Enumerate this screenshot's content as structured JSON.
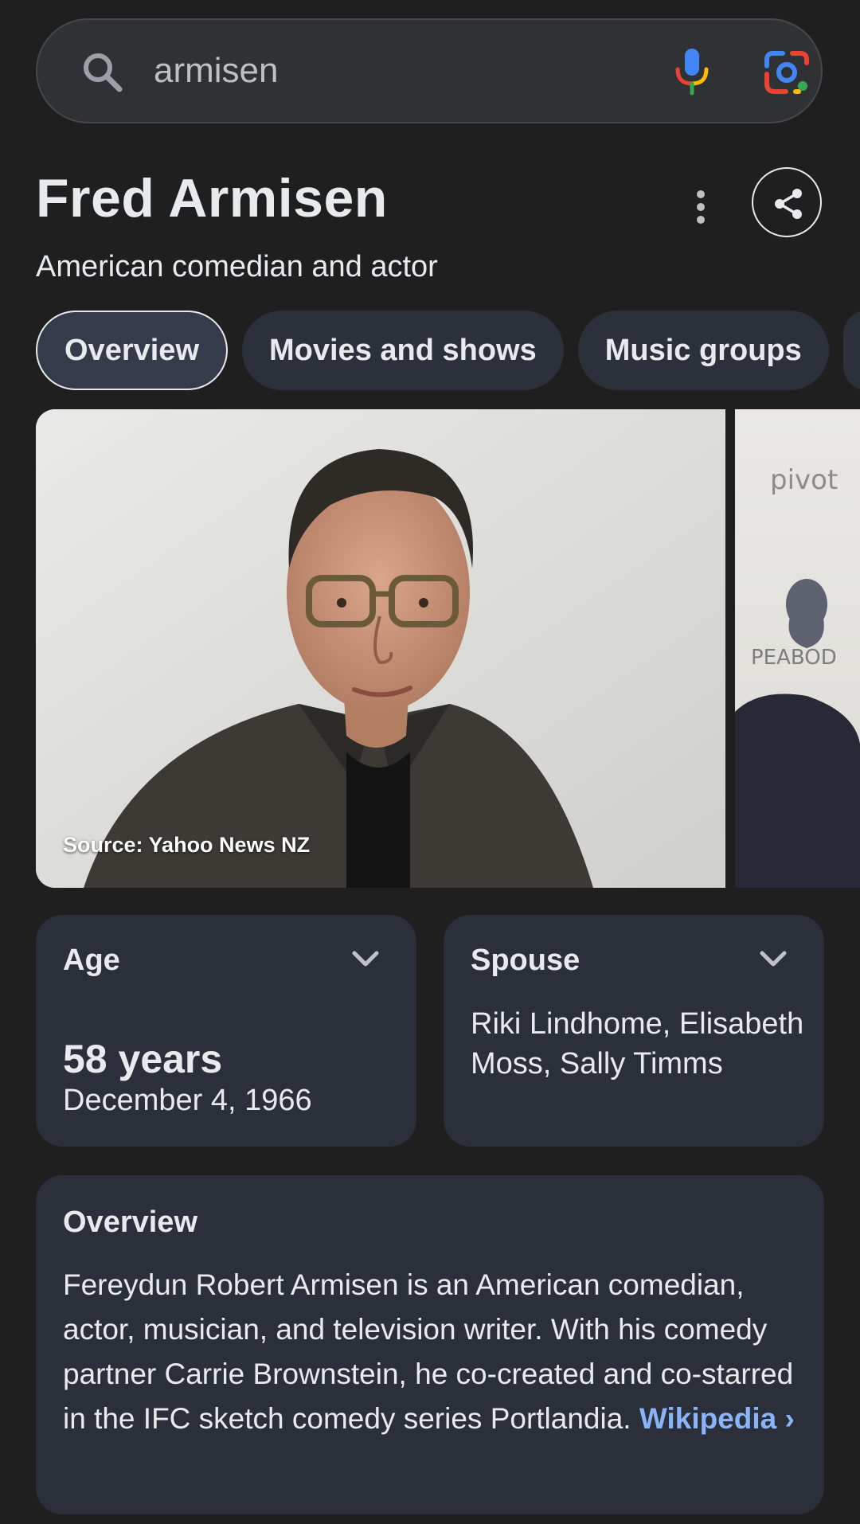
{
  "search": {
    "query": "armisen"
  },
  "header": {
    "title": "Fred Armisen",
    "subtitle": "American comedian and actor"
  },
  "chips": [
    {
      "label": "Overview"
    },
    {
      "label": "Movies and shows"
    },
    {
      "label": "Music groups"
    }
  ],
  "images": {
    "main_source": "Source: Yahoo News NZ",
    "side_sign_top": "pivot",
    "side_sign_bottom": "PEABOD"
  },
  "facts": {
    "age": {
      "label": "Age",
      "value": "58 years",
      "date": "December 4, 1966"
    },
    "spouse": {
      "label": "Spouse",
      "value": "Riki Lindhome, Elisabeth Moss, Sally Timms"
    }
  },
  "overview": {
    "title": "Overview",
    "text": "Fereydun Robert Armisen is an American comedian, actor, musician, and television writer. With his comedy partner Carrie Brownstein, he co-created and co-starred in the IFC sketch comedy series Portlandia.",
    "link_label": "Wikipedia",
    "link_chevron": "›"
  },
  "colors": {
    "background": "#1f1f1f",
    "card": "#2b2f3a",
    "chip": "#2b303b",
    "link": "#8ab4f8",
    "mic_blue": "#4285f4",
    "mic_red": "#ea4335",
    "mic_yellow": "#fbbc04",
    "mic_green": "#34a853"
  },
  "icons": [
    "search-icon",
    "microphone-icon",
    "google-lens-icon",
    "more-vert-icon",
    "share-icon",
    "chevron-down-icon"
  ]
}
